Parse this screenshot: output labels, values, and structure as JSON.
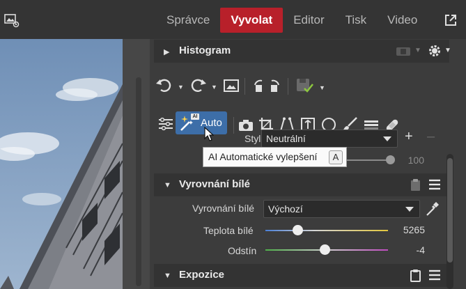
{
  "topbar": {
    "modes": [
      "Správce",
      "Vyvolat",
      "Editor",
      "Tisk",
      "Video"
    ],
    "active_mode": "Vyvolat"
  },
  "panel": {
    "histogram": {
      "title": "Histogram"
    },
    "tools": {
      "auto_label": "Auto",
      "ai_badge": "AI"
    },
    "tooltip": {
      "text": "AI Automatické vylepšení",
      "shortcut": "A"
    },
    "style_row": {
      "label_partial": "Styl",
      "value": "Neutrální",
      "strength": "100"
    },
    "white_balance": {
      "title": "Vyrovnání bílé",
      "mode_label": "Vyrovnání bílé",
      "mode_value": "Výchozí",
      "temperature": {
        "label": "Teplota bílé",
        "value": "5265",
        "position": 0.27
      },
      "tint": {
        "label": "Odstín",
        "value": "-4",
        "position": 0.49
      }
    },
    "exposure": {
      "title": "Expozice"
    }
  },
  "colors": {
    "accent_active_mode": "#b8202a",
    "auto_button": "#3d6ea8"
  }
}
